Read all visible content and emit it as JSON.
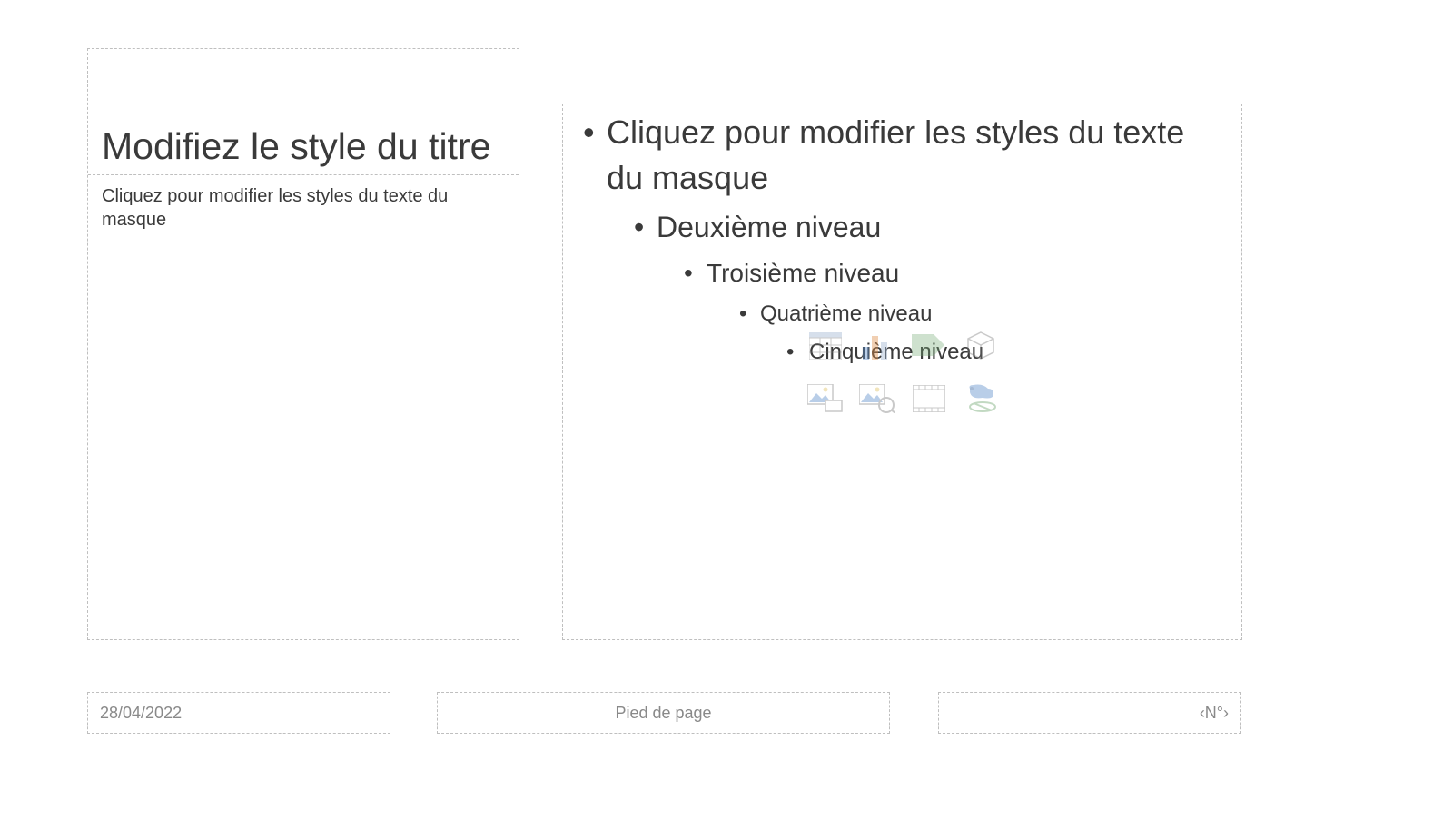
{
  "left": {
    "title": "Modifiez le style du titre",
    "subtitle": "Cliquez pour modifier les styles du texte du masque"
  },
  "right": {
    "level1": "Cliquez pour modifier les styles du texte du masque",
    "level2": "Deuxième niveau",
    "level3": "Troisième niveau",
    "level4": "Quatrième niveau",
    "level5": "Cinquième niveau"
  },
  "footer": {
    "date": "28/04/2022",
    "center": "Pied de page",
    "page": "‹N°›"
  }
}
